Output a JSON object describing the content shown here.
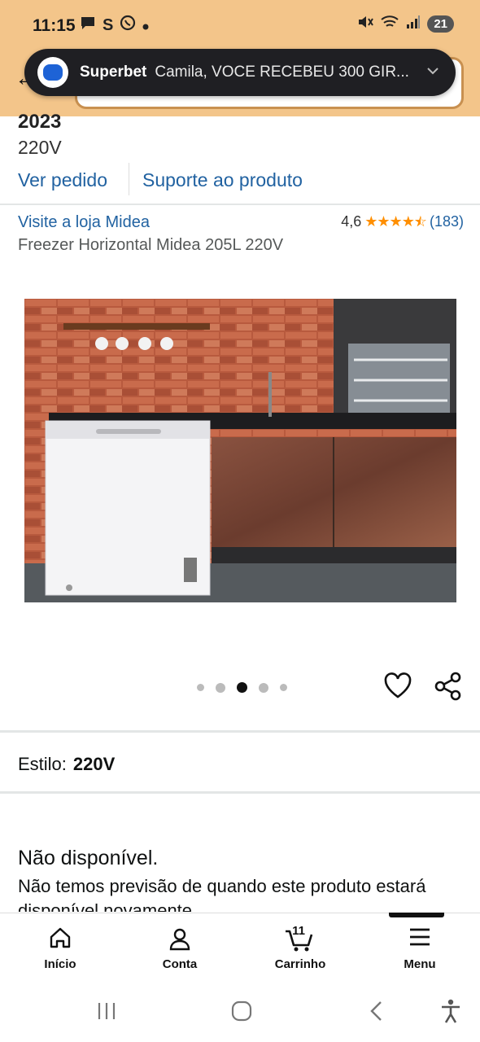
{
  "status_bar": {
    "time": "11:15",
    "left_icons": [
      "chat-bubble-icon",
      "s-icon",
      "whatsapp-icon",
      "dot-icon"
    ],
    "right_icons": [
      "mute-icon",
      "wifi-icon",
      "signal-icon"
    ],
    "battery": "21"
  },
  "notification": {
    "app": "Superbet",
    "message": "Camila, VOCE RECEBEU 300 GIR..."
  },
  "product": {
    "year_fragment": "2023",
    "voltage": "220V",
    "link_order": "Ver pedido",
    "link_support": "Suporte ao produto",
    "store_link": "Visite a loja Midea",
    "rating": "4,6",
    "rating_count": "(183)",
    "stars_value": 4.6,
    "title": "Freezer Horizontal Midea 205L 220V",
    "image_index": 3,
    "image_count": 5
  },
  "style": {
    "label": "Estilo:",
    "value": "220V"
  },
  "availability": {
    "title": "Não disponível.",
    "text": "Não temos previsão de quando este produto estará disponível novamente."
  },
  "bottom_nav": [
    {
      "label": "Início",
      "icon": "home-icon"
    },
    {
      "label": "Conta",
      "icon": "person-icon"
    },
    {
      "label": "Carrinho",
      "icon": "cart-icon",
      "count": "11"
    },
    {
      "label": "Menu",
      "icon": "menu-icon",
      "active": true
    }
  ],
  "colors": {
    "header": "#f3c58a",
    "link": "#2162a1",
    "star": "#ff8f00"
  }
}
